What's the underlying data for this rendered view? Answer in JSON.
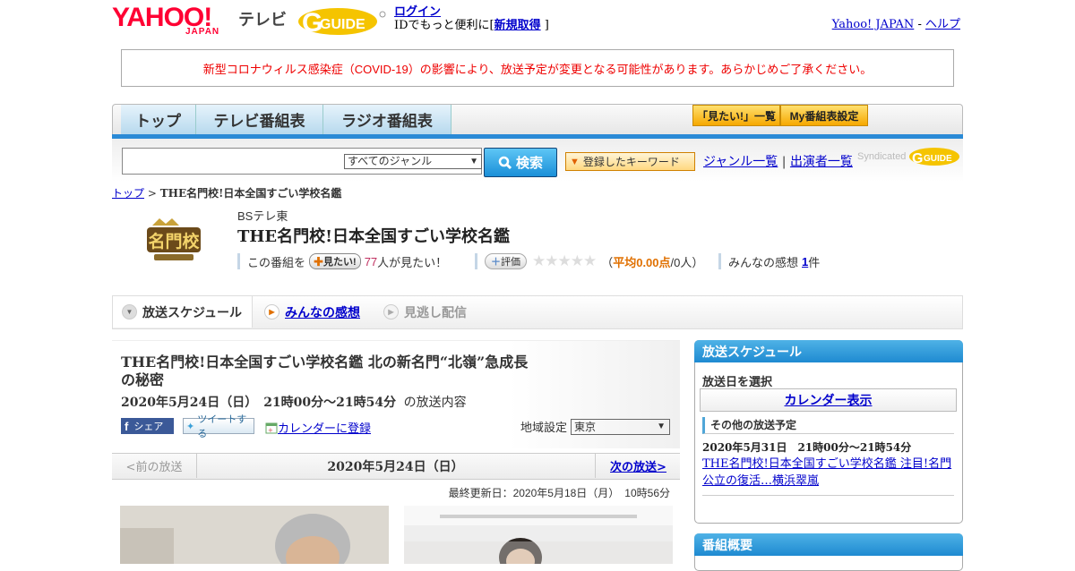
{
  "header": {
    "logo_text": "YAHOO!",
    "logo_sub": "JAPAN",
    "tv_label": "テレビ",
    "gguide_text": "GUIDE",
    "login_label": "ログイン",
    "login_desc_prefix": "IDでもっと便利に[",
    "signup_label": "新規取得",
    "login_desc_suffix": "]",
    "yahoo_japan_link": "Yahoo! JAPAN",
    "separator": "-",
    "help_link": "ヘルプ"
  },
  "notice": "新型コロナウィルス感染症（COVID-19）の影響により、放送予定が変更となる可能性があります。あらかじめご了承ください。",
  "nav": {
    "tabs": [
      "トップ",
      "テレビ番組表",
      "ラジオ番組表"
    ],
    "mitai_list": "「見たい!」一覧",
    "my_settings": "My番組表設定"
  },
  "search": {
    "genre_selected": "すべてのジャンル",
    "search_button": "検索",
    "keyword_button": "登録したキーワード",
    "genre_list": "ジャンル一覧",
    "divider": "|",
    "performer_list": "出演者一覧",
    "syndicated": "Syndicated"
  },
  "breadcrumb": {
    "top": "トップ",
    "sep": ">",
    "current": "THE名門校!日本全国すごい学校名鑑"
  },
  "program": {
    "logo_text": "名門校",
    "channel": "BSテレ東",
    "title": "THE名門校!日本全国すごい学校名鑑",
    "mitai_prefix": "この番組を",
    "mitai_button": "見たい!",
    "mitai_count": "77",
    "mitai_suffix": "人が見たい！",
    "eval_button": "評価",
    "stars": "★★★★★",
    "avg_prefix": "（",
    "avg_label": "平均0.00点",
    "avg_suffix": "/0人）",
    "impressions_label": "みんなの感想",
    "impressions_count": "1",
    "impressions_suffix": "件"
  },
  "section_tabs": {
    "schedule": "放送スケジュール",
    "impressions": "みんなの感想",
    "missed": "見逃し配信"
  },
  "episode": {
    "title": "THE名門校!日本全国すごい学校名鑑 北の新名門“北嶺”急成長の秘密",
    "date": "2020年5月24日（日）　21時00分～21時54分",
    "date_suffix": "の放送内容",
    "share_fb": "シェア",
    "share_tw": "ツイートする",
    "calendar_register": "カレンダーに登録",
    "region_label": "地域設定",
    "region_value": "東京",
    "prev": "<前の放送",
    "current_date": "2020年5月24日（日）",
    "next": "次の放送>",
    "updated": "最終更新日：2020年5月18日（月）　10時56分"
  },
  "sidebar": {
    "schedule_head": "放送スケジュール",
    "select_date": "放送日を選択",
    "calendar_btn": "カレンダー表示",
    "other_head": "その他の放送予定",
    "other_date": "2020年5月31日　21時00分～21時54分",
    "other_link": "THE名門校!日本全国すごい学校名鑑 注目!名門公立の復活…横浜翠嵐",
    "summary_head": "番組概要"
  }
}
